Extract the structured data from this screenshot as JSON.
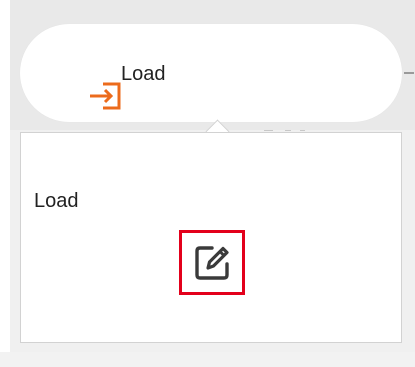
{
  "node": {
    "label": "Load",
    "icon": "load-arrow-icon",
    "accent_color": "#ec6b1c"
  },
  "popover": {
    "title": "Load",
    "edit_icon": "edit-pencil-icon",
    "highlight_color": "#e3001b"
  }
}
